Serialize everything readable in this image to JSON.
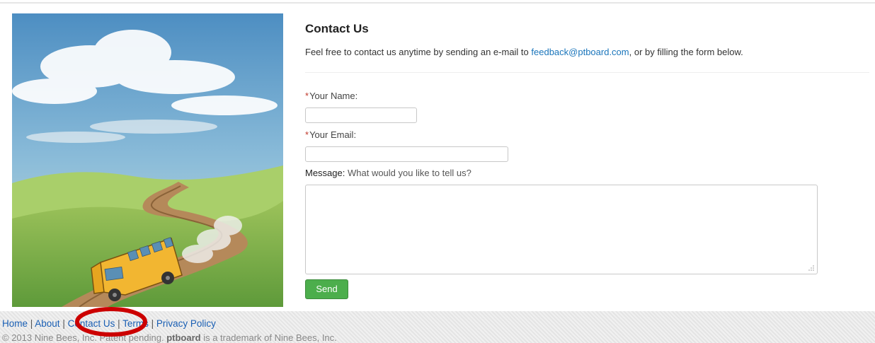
{
  "contact": {
    "title": "Contact Us",
    "intro_before": "Feel free to contact us anytime by sending an e-mail to ",
    "email_link": "feedback@ptboard.com",
    "intro_after": ", or by filling the form below.",
    "name_required": "*",
    "name_label": "Your Name:",
    "name_value": "",
    "email_required": "*",
    "email_label": "Your Email:",
    "email_value": "",
    "message_label": "Message:",
    "message_hint": " What would you like to tell us?",
    "message_value": "",
    "send_label": "Send"
  },
  "footer": {
    "links": [
      "Home",
      "About",
      "Contact Us",
      "Terms",
      "Privacy Policy"
    ],
    "separator": " | ",
    "copyright_before": "© 2013 Nine Bees, Inc. Patent pending. ",
    "brand": "ptboard",
    "copyright_after": " is a trademark of Nine Bees, Inc."
  },
  "colors": {
    "link": "#1a75bb",
    "send_button": "#4cae4c",
    "required_asterisk": "#c0392b",
    "highlight_annotation": "#cc0000"
  }
}
